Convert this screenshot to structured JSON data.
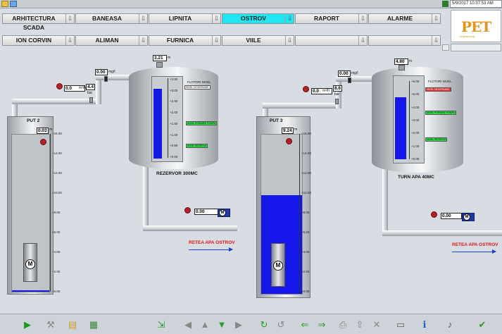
{
  "datetime": "5/9/2017 10:37:53 AM",
  "nav_row1": [
    {
      "label": "ARHITECTURA SCADA",
      "active": false
    },
    {
      "label": "BANEASA",
      "active": false
    },
    {
      "label": "LIPNITA",
      "active": false
    },
    {
      "label": "OSTROV",
      "active": true
    },
    {
      "label": "RAPORT",
      "active": false
    },
    {
      "label": "ALARME",
      "active": false
    }
  ],
  "nav_row2": [
    {
      "label": "ION CORVIN",
      "active": false
    },
    {
      "label": "ALIMAN",
      "active": false
    },
    {
      "label": "FURNICA",
      "active": false
    },
    {
      "label": "VIILE",
      "active": false
    },
    {
      "label": "",
      "active": false
    },
    {
      "label": "",
      "active": false
    }
  ],
  "logo": {
    "text": "PET",
    "sub": "engineering"
  },
  "site1": {
    "well_name": "PUT 2",
    "well_level": "0.03",
    "well_level_unit": "m",
    "flow": "0.0",
    "flow_unit": "m³/h",
    "pressure": "4.4",
    "pressure_unit": "bar",
    "chlorine": "0.00",
    "chlorine_unit": "mg/l",
    "tank_name": "REZERVOR 300MC",
    "tank_level": "3.21",
    "tank_level_unit": "m",
    "tank_level_value": 3.21,
    "tank_scale": [
      "+3.50",
      "+3.00",
      "+2.50",
      "+2.00",
      "+1.50",
      "+1.00",
      "+0.50",
      "+0.00"
    ],
    "well_scale": [
      "+15.00",
      "+14.00",
      "+12.00",
      "+10.00",
      "+8.00",
      "+6.00",
      "+4.00",
      "+2.00",
      "+0.00"
    ],
    "well_water_fraction": 0.01,
    "tank_water_fraction": 0.88,
    "float_title": "FLOTORI NIVEL",
    "float_badges": [
      "NIVEL DEVERSARE",
      "NIVEL PORNIRE POMPA",
      "NIVEL REZERVA"
    ],
    "out_flow": "0.00",
    "network": "RETEA APA OSTROV"
  },
  "site2": {
    "well_name": "PUT 3",
    "well_level": "9.24",
    "well_level_unit": "m",
    "flow": "0.0",
    "flow_unit": "m³/h",
    "pressure": "8.6",
    "pressure_unit": "bar",
    "chlorine": "0.00",
    "chlorine_unit": "mg/l",
    "tank_name": "TURN APA 40MC",
    "tank_level": "4.80",
    "tank_level_unit": "m",
    "tank_scale": [
      "+6.00",
      "+5.00",
      "+4.00",
      "+3.00",
      "+2.00",
      "+1.00",
      "+0.00"
    ],
    "well_scale": [
      "+15.00",
      "+14.00",
      "+12.00",
      "+10.00",
      "+8.00",
      "+6.00",
      "+4.00",
      "+2.00",
      "+0.00"
    ],
    "well_water_fraction": 0.62,
    "tank_water_fraction": 0.8,
    "float_title": "FLOTORI NIVEL",
    "float_badges": [
      "NIVEL DEVERSARE",
      "NIVEL PORNIRE POMPA",
      "NIVEL REZERVA"
    ],
    "out_flow": "0.00",
    "network": "RETEA APA OSTROV"
  },
  "motor_label": "M",
  "toolbar_icons": [
    "play-icon",
    "tools-icon",
    "note-icon",
    "document-icon",
    "import-icon",
    "arrow-left-icon",
    "arrow-up-icon",
    "arrow-down-icon",
    "arrow-right-icon",
    "refresh-icon",
    "refresh-alt-icon",
    "move-left-icon",
    "move-right-icon",
    "print-icon",
    "export-icon",
    "delete-icon",
    "screen-icon",
    "info-icon",
    "sound-icon",
    "check-icon"
  ]
}
